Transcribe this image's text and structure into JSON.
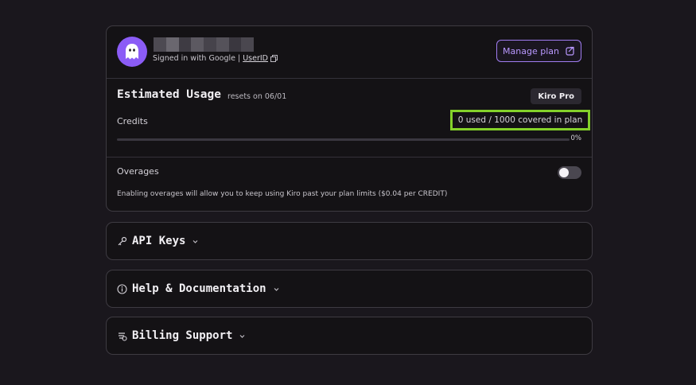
{
  "account": {
    "signed_in_text": "Signed in with Google |",
    "user_id_link": "UserID",
    "manage_plan_label": "Manage plan",
    "redacted_colors": [
      "#4d4a52",
      "#6a676f",
      "#3e3b43",
      "#5c5961",
      "#46434b",
      "#55525a",
      "#3a373f",
      "#4a474f"
    ]
  },
  "usage": {
    "title": "Estimated Usage",
    "resets_text": "resets on 06/01",
    "plan_badge": "Kiro Pro",
    "credits_label": "Credits",
    "credits_value": "0 used / 1000 covered in plan",
    "progress_fraction": 0,
    "progress_text": "0%"
  },
  "overages": {
    "label": "Overages",
    "enabled": false,
    "description": "Enabling overages will allow you to keep using Kiro past your plan limits ($0.04 per CREDIT)"
  },
  "sections": {
    "api_keys": "API Keys",
    "help": "Help & Documentation",
    "billing": "Billing Support"
  },
  "colors": {
    "accent": "#8b5cf6",
    "highlight": "#84d12a"
  }
}
